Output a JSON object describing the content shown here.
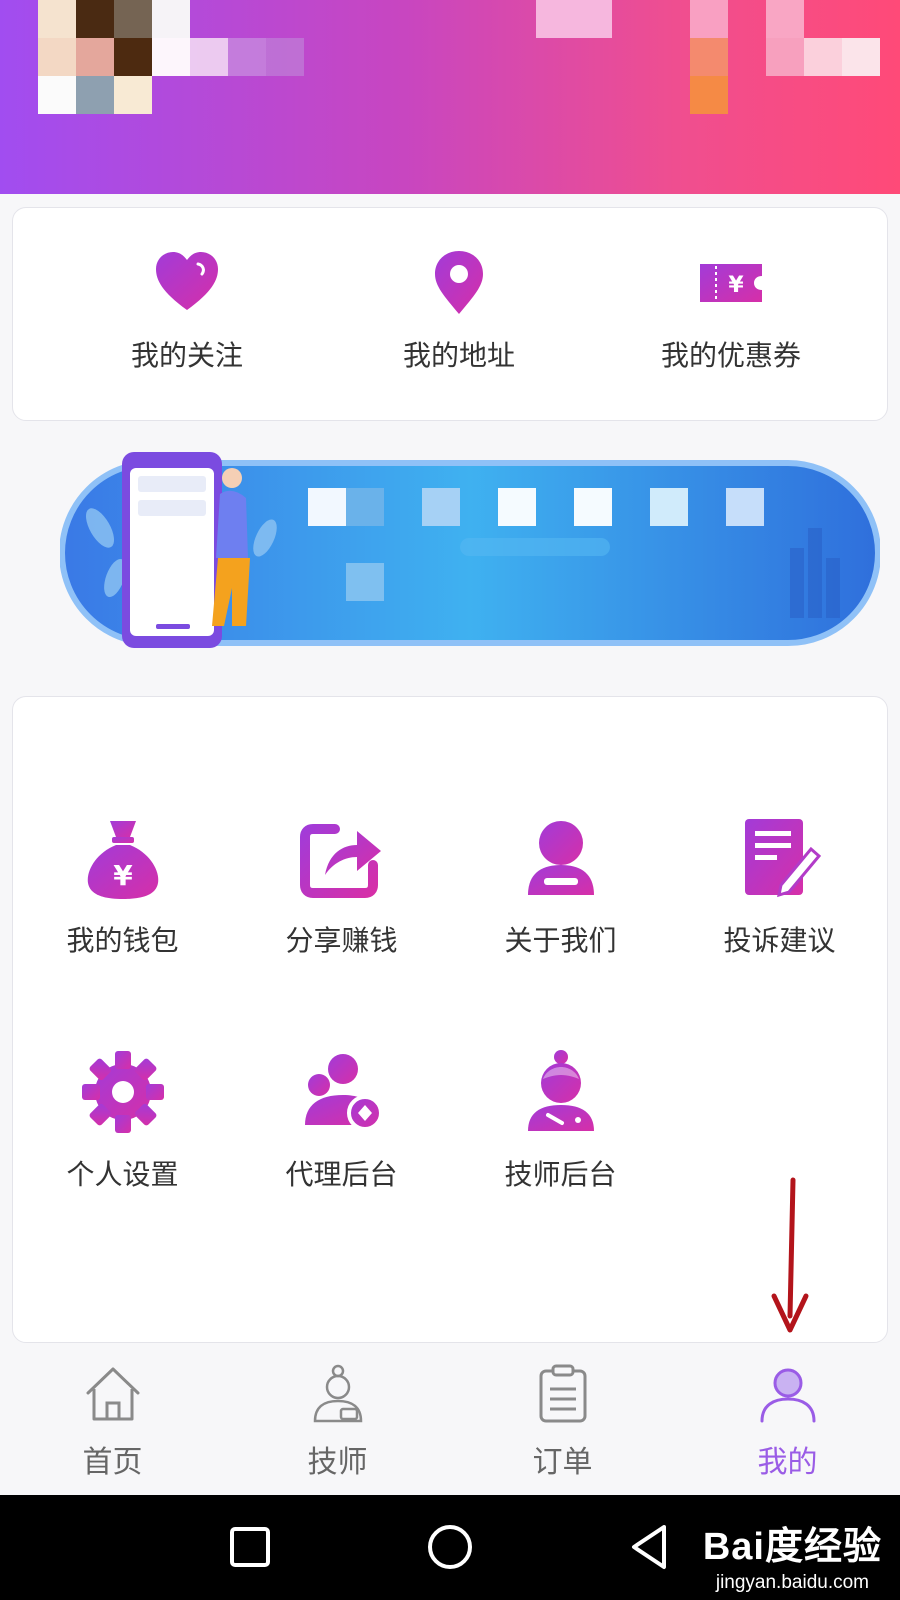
{
  "quick_links": [
    {
      "label": "我的关注",
      "icon": "heart-icon"
    },
    {
      "label": "我的地址",
      "icon": "location-pin-icon"
    },
    {
      "label": "我的优惠券",
      "icon": "coupon-icon"
    }
  ],
  "menu": {
    "items": [
      {
        "label": "我的钱包",
        "icon": "money-bag-icon"
      },
      {
        "label": "分享赚钱",
        "icon": "share-icon"
      },
      {
        "label": "关于我们",
        "icon": "person-icon"
      },
      {
        "label": "投诉建议",
        "icon": "edit-note-icon"
      },
      {
        "label": "个人设置",
        "icon": "gear-icon"
      },
      {
        "label": "代理后台",
        "icon": "agent-icon"
      },
      {
        "label": "技师后台",
        "icon": "technician-icon"
      }
    ]
  },
  "tabbar": {
    "tabs": [
      {
        "label": "首页",
        "icon": "home-icon",
        "active": false
      },
      {
        "label": "技师",
        "icon": "technician-icon",
        "active": false
      },
      {
        "label": "订单",
        "icon": "clipboard-icon",
        "active": false
      },
      {
        "label": "我的",
        "icon": "user-icon",
        "active": true
      }
    ]
  },
  "watermark": {
    "logo": "Bai度经验",
    "url": "jingyan.baidu.com"
  },
  "colors": {
    "accent": "#9a5ce6",
    "icon_start": "#a23bd8",
    "icon_end": "#d62fa8",
    "annotation_arrow": "#b3141b"
  }
}
